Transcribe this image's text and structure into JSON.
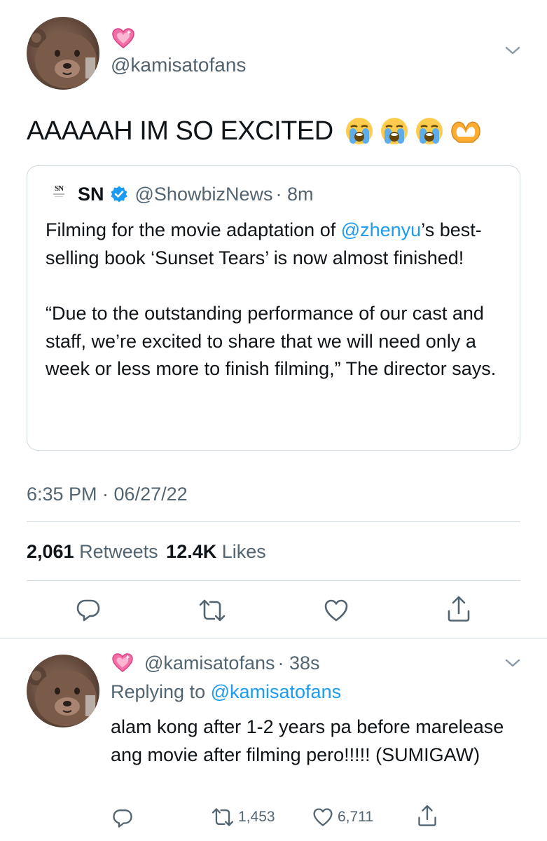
{
  "main_tweet": {
    "handle": "@kamisatofans",
    "text": "AAAAAH IM SO EXCITED",
    "emojis": [
      "loudly-crying-face",
      "loudly-crying-face",
      "loudly-crying-face",
      "heart-hands"
    ],
    "timestamp": "6:35 PM · 06/27/22",
    "retweets_count": "2,061",
    "retweets_label": "Retweets",
    "likes_count": "12.4K",
    "likes_label": "Likes"
  },
  "quoted_tweet": {
    "logo_text": "SN",
    "name": "SN",
    "handle": "@ShowbizNews",
    "time": "· 8m",
    "text_before_mention": "Filming for the movie adaptation of ",
    "mention": "@zhenyu",
    "text_after_mention": "’s best-selling book ‘Sunset Tears’ is now almost finished!",
    "paragraph2": "“Due to the outstanding performance of our cast and staff, we’re excited to share that we will need only a week or less more to finish filming,” The director says."
  },
  "reply_tweet": {
    "handle": "@kamisatofans",
    "time": "· 38s",
    "replying_label": "Replying to",
    "replying_handle": "@kamisatofans",
    "text": "alam kong after 1-2 years pa before marelease ang movie after filming pero!!!!! (SUMIGAW)",
    "retweets": "1,453",
    "likes": "6,711"
  },
  "colors": {
    "accent": "#1d9bf0",
    "text": "#0f1419",
    "muted": "#536471",
    "border": "#cfd9de",
    "verified": "#1d9bf0"
  }
}
